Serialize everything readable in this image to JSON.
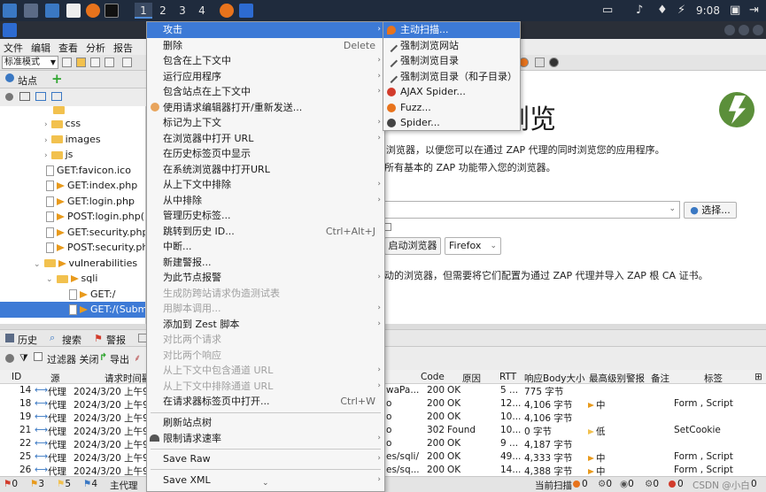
{
  "taskbar": {
    "workspaces": [
      "1",
      "2",
      "3",
      "4"
    ],
    "clock": "9:08"
  },
  "menubar": {
    "items": [
      "文件",
      "编辑",
      "查看",
      "分析",
      "报告"
    ]
  },
  "toolbar": {
    "mode": "标准模式"
  },
  "sites": {
    "tab_label": "站点",
    "tree": [
      {
        "label": "css",
        "kind": "folder",
        "indent": 1
      },
      {
        "label": "images",
        "kind": "folder",
        "indent": 1
      },
      {
        "label": "js",
        "kind": "folder",
        "indent": 1
      },
      {
        "label": "GET:favicon.ico",
        "kind": "file",
        "indent": 1
      },
      {
        "label": "GET:index.php",
        "kind": "flag",
        "indent": 1
      },
      {
        "label": "GET:login.php",
        "kind": "flag",
        "indent": 1
      },
      {
        "label": "POST:login.php()(",
        "kind": "flag",
        "indent": 1
      },
      {
        "label": "GET:security.php",
        "kind": "flag",
        "indent": 1
      },
      {
        "label": "POST:security.ph",
        "kind": "flag",
        "indent": 1
      },
      {
        "label": "vulnerabilities",
        "kind": "flagfolder",
        "indent": 0
      },
      {
        "label": "sqli",
        "kind": "folder",
        "indent": 1
      },
      {
        "label": "GET:/",
        "kind": "flag",
        "indent": 2
      },
      {
        "label": "GET:/(Subm",
        "kind": "flag",
        "indent": 2,
        "selected": true
      }
    ]
  },
  "welcome": {
    "title_part": "浏览",
    "line1": "浏览器，以便您可以在通过 ZAP 代理的同时浏览您的应用程序。",
    "line2": "所有基本的 ZAP 功能带入您的浏览器。",
    "select_button": "选择...",
    "launch_button": "启动浏览器",
    "browser_option": "Firefox",
    "line3": "动的浏览器，但需要将它们配置为通过 ZAP 代理并导入 ZAP 根 CA 证书。"
  },
  "context_menu": {
    "items": [
      {
        "label": "攻击",
        "submenu": true,
        "highlight": true
      },
      {
        "label": "删除",
        "shortcut": "Delete"
      },
      {
        "label": "包含在上下文中",
        "submenu": true
      },
      {
        "label": "运行应用程序",
        "submenu": true
      },
      {
        "label": "包含站点在上下文中",
        "submenu": true
      },
      {
        "label": "使用请求编辑器打开/重新发送..."
      },
      {
        "label": "标记为上下文",
        "submenu": true
      },
      {
        "label": "在浏览器中打开 URL",
        "submenu": true
      },
      {
        "label": "在历史标签页中显示"
      },
      {
        "label": "在系统浏览器中打开URL"
      },
      {
        "label": "从上下文中排除",
        "submenu": true
      },
      {
        "label": "从中排除",
        "submenu": true
      },
      {
        "label": "管理历史标签..."
      },
      {
        "label": "跳转到历史 ID...",
        "shortcut": "Ctrl+Alt+J"
      },
      {
        "label": "中断..."
      },
      {
        "label": "新建警报..."
      },
      {
        "label": "为此节点报警",
        "submenu": true
      },
      {
        "label": "生成防跨站请求伪造测试表",
        "disabled": true
      },
      {
        "label": "用脚本调用...",
        "submenu": true,
        "disabled": true
      },
      {
        "label": "添加到 Zest 脚本",
        "submenu": true
      },
      {
        "label": "对比两个请求",
        "disabled": true
      },
      {
        "label": "对比两个响应",
        "disabled": true
      },
      {
        "label": "从上下文中包含通道 URL",
        "submenu": true,
        "disabled": true
      },
      {
        "label": "从上下文中排除通道 URL",
        "submenu": true,
        "disabled": true
      },
      {
        "label": "在请求器标签页中打开...",
        "shortcut": "Ctrl+W"
      },
      {
        "separator": true
      },
      {
        "label": "刷新站点树"
      },
      {
        "label": "限制请求速率",
        "submenu": true
      },
      {
        "separator": true
      },
      {
        "label": "Save Raw",
        "submenu": true
      },
      {
        "separator": true
      },
      {
        "label": "Save XML",
        "submenu": true
      }
    ]
  },
  "attack_submenu": {
    "items": [
      {
        "label": "主动扫描...",
        "icon": "flame-icon",
        "highlight": true
      },
      {
        "label": "强制浏览网站",
        "icon": "hammer-icon"
      },
      {
        "label": "强制浏览目录",
        "icon": "hammer-icon"
      },
      {
        "label": "强制浏览目录（和子目录）",
        "icon": "hammer-icon"
      },
      {
        "label": "AJAX Spider...",
        "icon": "spider-icon"
      },
      {
        "label": "Fuzz...",
        "icon": "fuzz-icon"
      },
      {
        "label": "Spider...",
        "icon": "spider-icon"
      }
    ]
  },
  "bottom": {
    "tabs": [
      "历史",
      "搜索",
      "警报"
    ],
    "filter_label": "过滤器 关闭",
    "export_label": "导出",
    "columns": {
      "id": "ID",
      "source": "源",
      "time": "请求时间戳",
      "code": "Code",
      "reason": "原因",
      "rtt": "RTT",
      "size": "响应Body大小",
      "alert": "最高级别警报",
      "note": "备注",
      "tags": "标签"
    },
    "rows": [
      {
        "id": "14",
        "source": "代理",
        "time": "2024/3/20 上午9",
        "url": "waPa...",
        "code": "200",
        "reason": "OK",
        "rtt": "5 ...",
        "size": "775 字节",
        "alert": "",
        "alert_color": "",
        "tags": ""
      },
      {
        "id": "18",
        "source": "代理",
        "time": "2024/3/20 上午9",
        "url": "o",
        "code": "200",
        "reason": "OK",
        "rtt": "12...",
        "size": "4,106 字节",
        "alert": "中",
        "alert_color": "#e89a1c",
        "tags": "Form , Script"
      },
      {
        "id": "19",
        "source": "代理",
        "time": "2024/3/20 上午9",
        "url": "o",
        "code": "200",
        "reason": "OK",
        "rtt": "10...",
        "size": "4,106 字节",
        "alert": "",
        "alert_color": "",
        "tags": ""
      },
      {
        "id": "21",
        "source": "代理",
        "time": "2024/3/20 上午9",
        "url": "o",
        "code": "302",
        "reason": "Found",
        "rtt": "10...",
        "size": "0 字节",
        "alert": "低",
        "alert_color": "#f2c14e",
        "tags": "SetCookie"
      },
      {
        "id": "22",
        "source": "代理",
        "time": "2024/3/20 上午9",
        "url": "o",
        "code": "200",
        "reason": "OK",
        "rtt": "9 ...",
        "size": "4,187 字节",
        "alert": "",
        "alert_color": "",
        "tags": ""
      },
      {
        "id": "25",
        "source": "代理",
        "time": "2024/3/20 上午9",
        "url": "es/sqli/",
        "code": "200",
        "reason": "OK",
        "rtt": "49...",
        "size": "4,333 字节",
        "alert": "中",
        "alert_color": "#e89a1c",
        "tags": "Form , Script"
      },
      {
        "id": "26",
        "source": "代理",
        "time": "2024/3/20 上午9",
        "url": "es/sq...",
        "code": "200",
        "reason": "OK",
        "rtt": "14...",
        "size": "4,388 字节",
        "alert": "中",
        "alert_color": "#e89a1c",
        "tags": "Form , Script"
      }
    ]
  },
  "status": {
    "alerts": [
      "0",
      "3",
      "5",
      "4"
    ],
    "main_thread": "主代理",
    "current_scan": "当前扫描",
    "scan_counts": [
      "0",
      "0",
      "0",
      "0",
      "0",
      "0"
    ],
    "watermark": "CSDN @小白"
  }
}
